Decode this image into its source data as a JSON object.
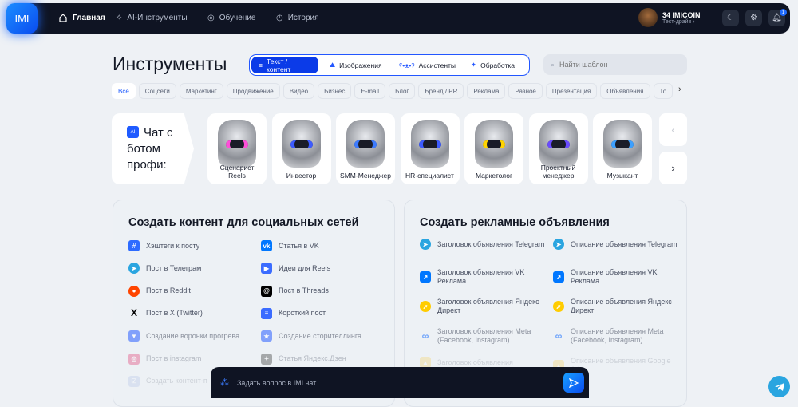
{
  "nav": {
    "logo": "IMI",
    "items": [
      {
        "label": "Главная",
        "icon": "home-icon"
      },
      {
        "label": "AI-Инструменты",
        "icon": "sparkle-icon"
      },
      {
        "label": "Обучение",
        "icon": "lifebuoy-icon"
      },
      {
        "label": "История",
        "icon": "history-icon"
      }
    ],
    "coins": "34 IMICOIN",
    "plan": "Тест-драйв",
    "notifications": "1"
  },
  "page": {
    "title": "Инструменты"
  },
  "modes": [
    {
      "label": "Текст / контент"
    },
    {
      "label": "Изображения"
    },
    {
      "label": "Ассистенты"
    },
    {
      "label": "Обработка"
    }
  ],
  "search": {
    "placeholder": "Найти шаблон"
  },
  "chips": [
    "Все",
    "Соцсети",
    "Маркетинг",
    "Продвижение",
    "Видео",
    "Бизнес",
    "E-mail",
    "Блог",
    "Бренд / PR",
    "Реклама",
    "Разное",
    "Презентация",
    "Объявления",
    "То"
  ],
  "chat_promo": {
    "badge": "AI",
    "text": "Чат с ботом профи:"
  },
  "bots": [
    "Сценарист Reels",
    "Инвестор",
    "SMM-Менеджер",
    "HR-специалист",
    "Маркетолог",
    "Проектный менеджер",
    "Музыкант"
  ],
  "social": {
    "title": "Создать контент для социальных сетей",
    "items": [
      {
        "label": "Хэштеги к посту",
        "icon": "hashtag-icon",
        "color": "#2d6bff"
      },
      {
        "label": "Статья в VK",
        "icon": "vk-icon",
        "color": "#0077ff"
      },
      {
        "label": "Пост в Телеграм",
        "icon": "telegram-icon",
        "color": "#2aa5e0"
      },
      {
        "label": "Идеи для Reels",
        "icon": "clapper-icon",
        "color": "#3b6cff"
      },
      {
        "label": "Пост в Reddit",
        "icon": "reddit-icon",
        "color": "#ff4500"
      },
      {
        "label": "Пост в Threads",
        "icon": "threads-icon",
        "color": "#000000"
      },
      {
        "label": "Пост в X (Twitter)",
        "icon": "x-icon",
        "color": "#000000"
      },
      {
        "label": "Короткий пост",
        "icon": "list-icon",
        "color": "#3b6cff"
      },
      {
        "label": "Создание воронки прогрева",
        "icon": "funnel-icon",
        "color": "#3b6cff"
      },
      {
        "label": "Создание сторителлинга",
        "icon": "bookmark-star-icon",
        "color": "#3b6cff"
      },
      {
        "label": "Пост в instagram",
        "icon": "instagram-icon",
        "color": "#e1306c"
      },
      {
        "label": "Статья Яндекс.Дзен",
        "icon": "dzen-icon",
        "color": "#222222"
      },
      {
        "label": "Создать контент-п",
        "icon": "checklist-icon",
        "color": "#8fa6e0"
      }
    ]
  },
  "ads": {
    "title": "Создать рекламные объявления",
    "items": [
      {
        "label": "Заголовок объявления Telegram",
        "icon": "telegram-icon",
        "color": "#2aa5e0"
      },
      {
        "label": "Описание объявления Telegram",
        "icon": "telegram-icon",
        "color": "#2aa5e0"
      },
      {
        "label": "Заголовок объявления VK Реклама",
        "icon": "vk-ads-icon",
        "color": "#0077ff"
      },
      {
        "label": "Описание объявления VK Реклама",
        "icon": "vk-ads-icon",
        "color": "#0077ff"
      },
      {
        "label": "Заголовок объявления Яндекс Директ",
        "icon": "yandex-direct-icon",
        "color": "#ffcc00"
      },
      {
        "label": "Описание объявления Яндекс Директ",
        "icon": "yandex-direct-icon",
        "color": "#ffcc00"
      },
      {
        "label": "Заголовок объявления Meta (Facebook, Instagram)",
        "icon": "meta-icon",
        "color": "#0a66ff"
      },
      {
        "label": "Описание объявления Meta (Facebook, Instagram)",
        "icon": "meta-icon",
        "color": "#0a66ff"
      },
      {
        "label": "Заголовок объявления",
        "icon": "google-ads-icon",
        "color": "#fbbc04"
      },
      {
        "label": "Описание объявления Google Ads",
        "icon": "google-ads-icon",
        "color": "#fbbc04"
      }
    ]
  },
  "chat": {
    "placeholder": "Задать вопрос в IMI чат"
  }
}
